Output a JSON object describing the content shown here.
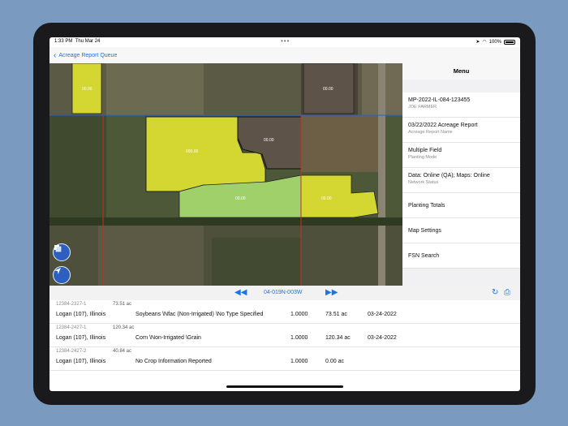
{
  "status_bar": {
    "time": "1:33 PM",
    "date": "Thu Mar 24",
    "battery": "100%"
  },
  "nav": {
    "back_label": "Acreage Report Queue"
  },
  "map": {
    "field_labels": [
      "00.00",
      "00.00",
      "000.00",
      "00.00",
      "00.00",
      "00.00"
    ]
  },
  "menu": {
    "title": "Menu",
    "items": [
      {
        "main": "MP-2022-IL-084-123455",
        "sub": "JOE FARMER"
      },
      {
        "main": "03/22/2022 Acreage Report",
        "sub": "Acreage Report Name"
      },
      {
        "main": "Multiple Field",
        "sub": "Planting Mode"
      },
      {
        "main": "Data: Online (QA); Maps: Online",
        "sub": "Network Status"
      },
      {
        "main": "Planting Totals"
      },
      {
        "main": "Map Settings"
      },
      {
        "main": "FSN Search"
      }
    ]
  },
  "toolbar": {
    "section": "04-019N-003W"
  },
  "rows": [
    {
      "id": "12384-2327-1",
      "acres_top": "73.51 ac",
      "county": "Logan (107), Illinois",
      "crop": "Soybeans \\Nfac (Non-Irrigated) \\No Type Specified",
      "share": "1.0000",
      "acres": "73.51 ac",
      "date": "03-24-2022"
    },
    {
      "id": "12384-2427-1",
      "acres_top": "120.34 ac",
      "county": "Logan (107), Illinois",
      "crop": "Corn \\Non-Irrigated \\Grain",
      "share": "1.0000",
      "acres": "120.34 ac",
      "date": "03-24-2022"
    },
    {
      "id": "12384-2427-2",
      "acres_top": "40.84 ac",
      "county": "Logan (107), Illinois",
      "crop": "No Crop Information Reported",
      "share": "1.0000",
      "acres": "0.00 ac",
      "date": ""
    }
  ],
  "colors": {
    "accent": "#1a73e8",
    "field_yellow": "#d4d632",
    "field_light_green": "#9fd06a",
    "field_brown": "#5e5348",
    "boundary_red": "#c0302a",
    "boundary_blue": "#2a5fd0"
  }
}
